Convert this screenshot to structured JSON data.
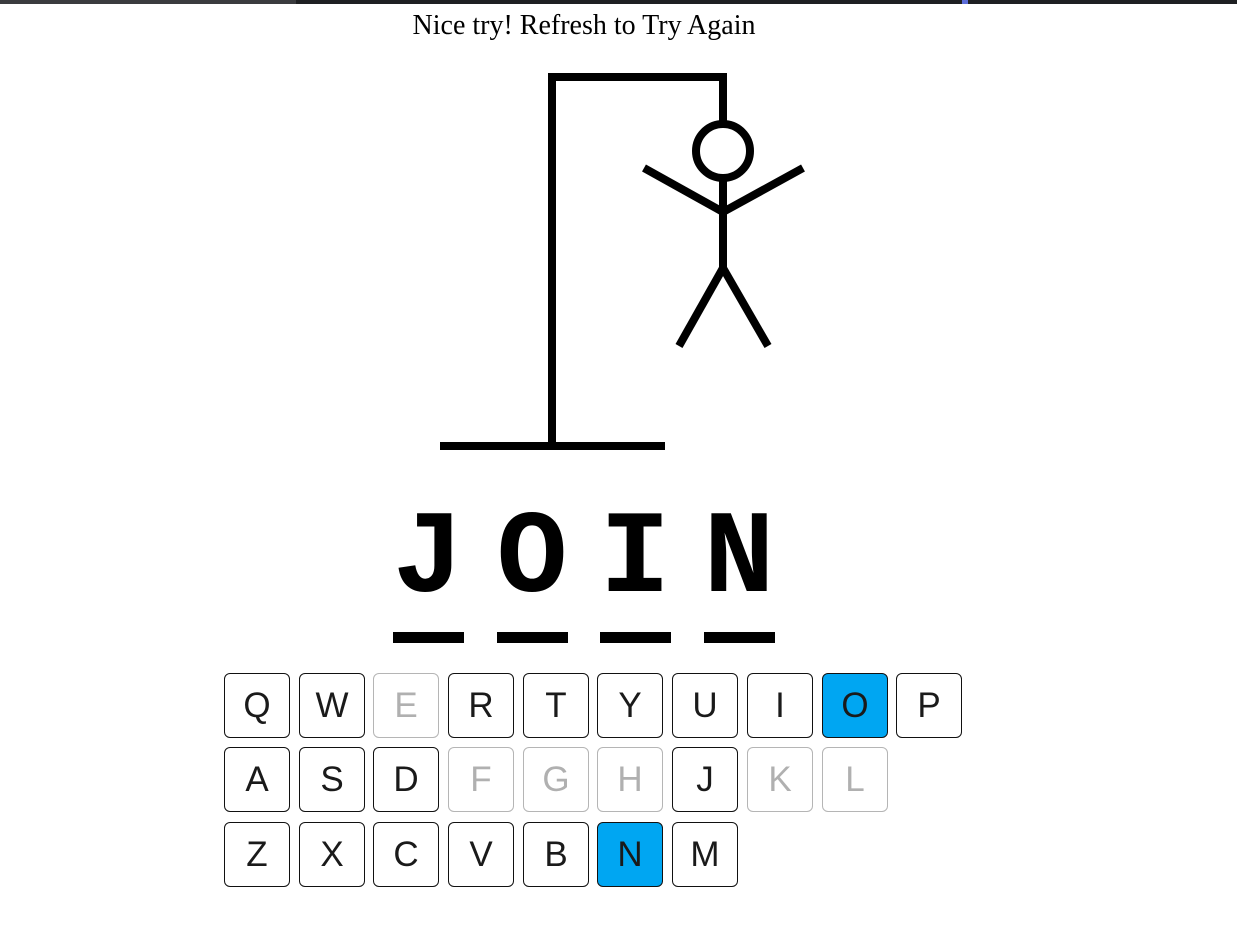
{
  "status_message": "Nice try! Refresh to Try Again",
  "colors": {
    "correct_key_bg": "#00a6f2",
    "used_key_text": "#b0b0b0",
    "key_border": "#111111",
    "drawing": "#000000"
  },
  "hangman": {
    "parts_shown": [
      "base",
      "pole",
      "beam",
      "rope",
      "head",
      "body",
      "left-arm",
      "right-arm",
      "left-leg",
      "right-leg"
    ]
  },
  "word": {
    "letters": [
      "J",
      "O",
      "I",
      "N"
    ]
  },
  "keyboard": {
    "rows": [
      [
        {
          "label": "Q",
          "state": "unused"
        },
        {
          "label": "W",
          "state": "unused"
        },
        {
          "label": "E",
          "state": "used"
        },
        {
          "label": "R",
          "state": "unused"
        },
        {
          "label": "T",
          "state": "unused"
        },
        {
          "label": "Y",
          "state": "unused"
        },
        {
          "label": "U",
          "state": "unused"
        },
        {
          "label": "I",
          "state": "unused"
        },
        {
          "label": "O",
          "state": "correct"
        },
        {
          "label": "P",
          "state": "unused"
        }
      ],
      [
        {
          "label": "A",
          "state": "unused"
        },
        {
          "label": "S",
          "state": "unused"
        },
        {
          "label": "D",
          "state": "unused"
        },
        {
          "label": "F",
          "state": "used"
        },
        {
          "label": "G",
          "state": "used"
        },
        {
          "label": "H",
          "state": "used"
        },
        {
          "label": "J",
          "state": "unused"
        },
        {
          "label": "K",
          "state": "used"
        },
        {
          "label": "L",
          "state": "used"
        }
      ],
      [
        {
          "label": "Z",
          "state": "unused"
        },
        {
          "label": "X",
          "state": "unused"
        },
        {
          "label": "C",
          "state": "unused"
        },
        {
          "label": "V",
          "state": "unused"
        },
        {
          "label": "B",
          "state": "unused"
        },
        {
          "label": "N",
          "state": "correct"
        },
        {
          "label": "M",
          "state": "unused"
        }
      ]
    ]
  }
}
